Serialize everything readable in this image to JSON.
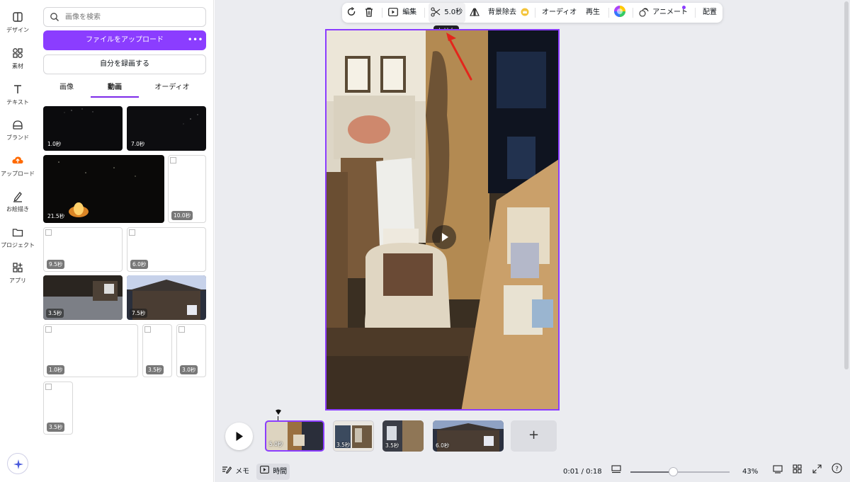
{
  "rail": {
    "items": [
      {
        "label": "デザイン",
        "icon": "layout-icon"
      },
      {
        "label": "素材",
        "icon": "shapes-icon"
      },
      {
        "label": "テキスト",
        "icon": "text-icon"
      },
      {
        "label": "ブランド",
        "icon": "brand-icon"
      },
      {
        "label": "アップロード",
        "icon": "upload-cloud-icon",
        "active": true
      },
      {
        "label": "お絵描き",
        "icon": "draw-icon"
      },
      {
        "label": "プロジェクト",
        "icon": "folder-icon"
      },
      {
        "label": "アプリ",
        "icon": "apps-icon"
      }
    ]
  },
  "panel": {
    "search_placeholder": "画像を検索",
    "upload_label": "ファイルをアップロード",
    "upload_more": "•••",
    "record_label": "自分を録画する",
    "tabs": [
      "画像",
      "動画",
      "オーディオ"
    ],
    "active_tab": "動画",
    "media": [
      {
        "duration": "1.0秒",
        "kind": "dark"
      },
      {
        "duration": "7.0秒",
        "kind": "dark"
      },
      {
        "duration": "21.5秒",
        "kind": "fire"
      },
      {
        "duration": "10.0秒",
        "kind": "broken"
      },
      {
        "duration": "9.5秒",
        "kind": "broken"
      },
      {
        "duration": "6.0秒",
        "kind": "broken"
      },
      {
        "duration": "3.5秒",
        "kind": "photo"
      },
      {
        "duration": "7.5秒",
        "kind": "photo"
      },
      {
        "duration": "1.0秒",
        "kind": "broken"
      },
      {
        "duration": "3.5秒",
        "kind": "broken"
      },
      {
        "duration": "3.0秒",
        "kind": "broken"
      },
      {
        "duration": "3.5秒",
        "kind": "broken"
      }
    ]
  },
  "toolbar": {
    "edit_label": "編集",
    "trim_duration": "5.0秒",
    "bg_remove_label": "背景除去",
    "audio_label": "オーディオ",
    "playback_label": "再生",
    "animate_label": "アニメート",
    "arrange_label": "配置",
    "tooltip": "トリム"
  },
  "timeline": {
    "clips": [
      {
        "duration": "5.0秒",
        "selected": true
      },
      {
        "duration": "3.5秒",
        "selected": false
      },
      {
        "duration": "3.5秒",
        "selected": false
      },
      {
        "duration": "6.0秒",
        "selected": false
      }
    ],
    "add_label": "+"
  },
  "bottombar": {
    "notes_label": "メモ",
    "time_label": "時間",
    "timecode": "0:01 / 0:18",
    "zoom": "43%",
    "zoom_fraction": 0.43,
    "help": "?"
  },
  "colors": {
    "accent": "#8b3dff",
    "canvas_bg": "#ebecf0",
    "upload_orange": "#ff6a00"
  }
}
